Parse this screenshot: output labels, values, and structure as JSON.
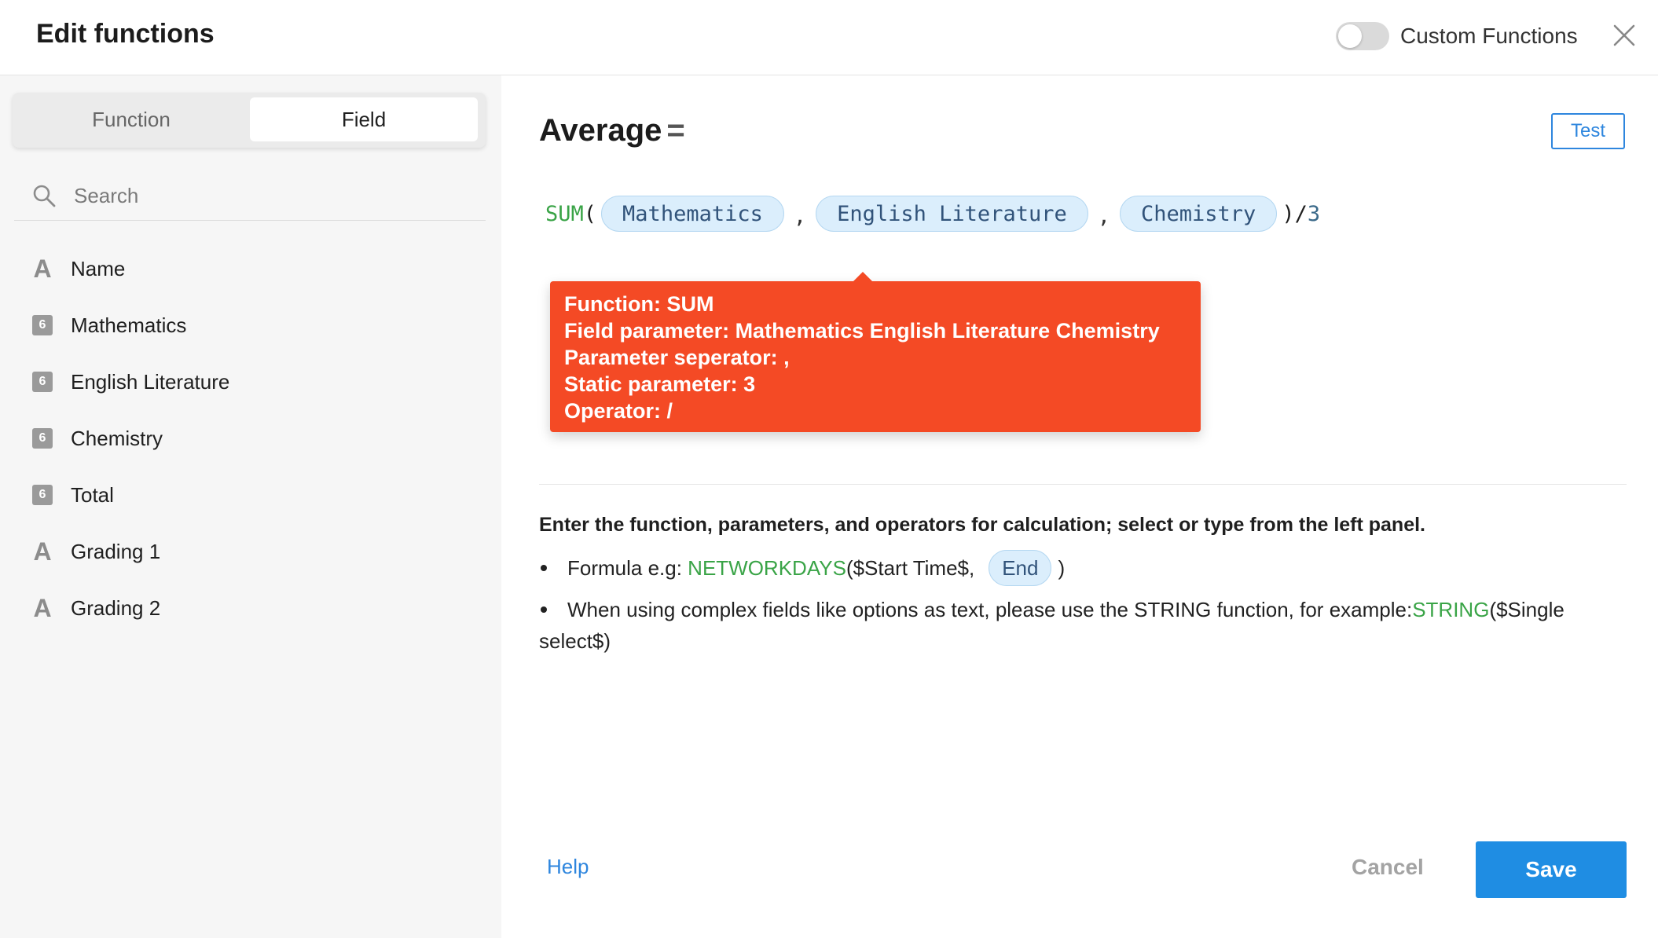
{
  "header": {
    "title": "Edit functions",
    "toggle_label": "Custom Functions"
  },
  "sidebar": {
    "tabs": [
      {
        "label": "Function"
      },
      {
        "label": "Field"
      }
    ],
    "search_placeholder": "Search",
    "fields": [
      {
        "label": "Name",
        "type": "text",
        "icon": "A"
      },
      {
        "label": "Mathematics",
        "type": "number",
        "icon": "6"
      },
      {
        "label": "English Literature",
        "type": "number",
        "icon": "6"
      },
      {
        "label": "Chemistry",
        "type": "number",
        "icon": "6"
      },
      {
        "label": "Total",
        "type": "number",
        "icon": "6"
      },
      {
        "label": "Grading 1",
        "type": "text",
        "icon": "A"
      },
      {
        "label": "Grading 2",
        "type": "text",
        "icon": "A"
      }
    ]
  },
  "editor": {
    "field_name": "Average",
    "equals": "=",
    "test_label": "Test",
    "formula": {
      "function": "SUM",
      "open_paren": "(",
      "params": [
        "Mathematics",
        "English Literature",
        "Chemistry"
      ],
      "separator": ",",
      "close_and_operator": ")/",
      "static": "3"
    },
    "tooltip": {
      "line1": "Function: SUM",
      "line2": "Field parameter: Mathematics  English Literature  Chemistry",
      "line3": "Parameter seperator: ,",
      "line4": "Static parameter: 3",
      "line5": "Operator: /"
    },
    "instruction": "Enter the function, parameters, and operators for calculation; select or type from the left panel.",
    "example1": {
      "prefix": "Formula e.g: ",
      "function": "NETWORKDAYS",
      "args": "($Start Time$,",
      "chip": "End",
      "suffix": ")"
    },
    "example2": {
      "prefix": "When using complex fields like options as text, please use the STRING function, for example:",
      "function": "STRING",
      "suffix": "($Single select$)"
    }
  },
  "footer": {
    "help": "Help",
    "cancel": "Cancel",
    "save": "Save"
  },
  "colors": {
    "accent": "#1f8de3",
    "tooltip_bg": "#f44a25",
    "function_green": "#3aa447",
    "chip_bg": "#dbeefc"
  }
}
